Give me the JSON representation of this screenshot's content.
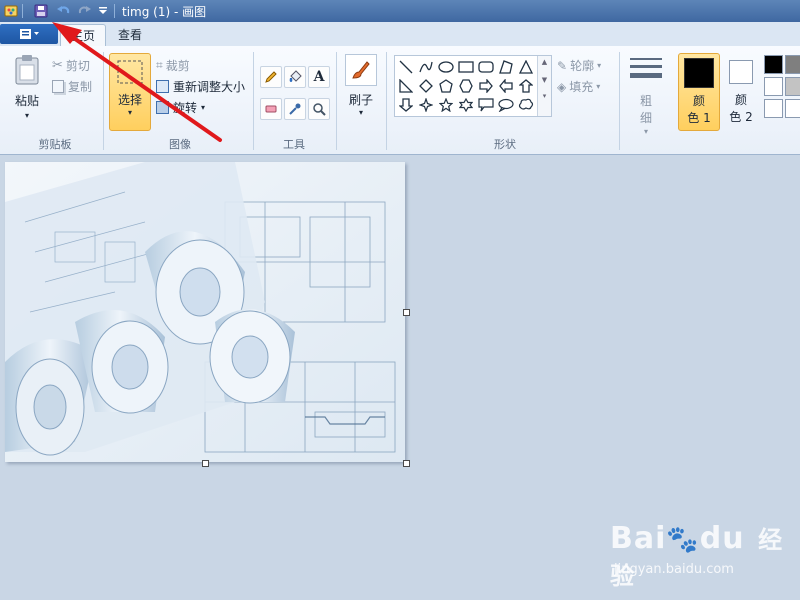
{
  "window": {
    "title": "timg (1) - 画图"
  },
  "tabs": [
    {
      "label": "主页",
      "active": true
    },
    {
      "label": "查看",
      "active": false
    }
  ],
  "ribbon": {
    "clipboard": {
      "paste": "粘贴",
      "cut": "剪切",
      "copy": "复制",
      "label": "剪贴板"
    },
    "image": {
      "select": "选择",
      "crop": "裁剪",
      "resize": "重新调整大小",
      "rotate": "旋转",
      "label": "图像"
    },
    "tools": {
      "label": "工具",
      "text_tool_glyph": "A"
    },
    "brushes": {
      "label": "刷子"
    },
    "shapes": {
      "label": "形状",
      "outline": "轮廓",
      "fill": "填充"
    },
    "size": {
      "label": "粗细"
    },
    "color1": {
      "label": "颜色 1",
      "line1": "颜",
      "line2": "色 1",
      "color": "#000000"
    },
    "color2": {
      "label": "颜色 2",
      "line1": "颜",
      "line2": "色 2",
      "color": "#ffffff"
    },
    "palette": [
      "#000000",
      "#7f7f7f",
      "#ffffff",
      "#c3c3c3",
      "#ffffff",
      "#ffffff"
    ]
  },
  "watermark": {
    "brand": "Bai",
    "brand2": "du",
    "brand_cn": "经验",
    "url": "jingyan.baidu.com"
  },
  "colors": {
    "accent": "#1e56a3",
    "arrow": "#e0191c",
    "select_highlight": "#ffcf5e"
  }
}
